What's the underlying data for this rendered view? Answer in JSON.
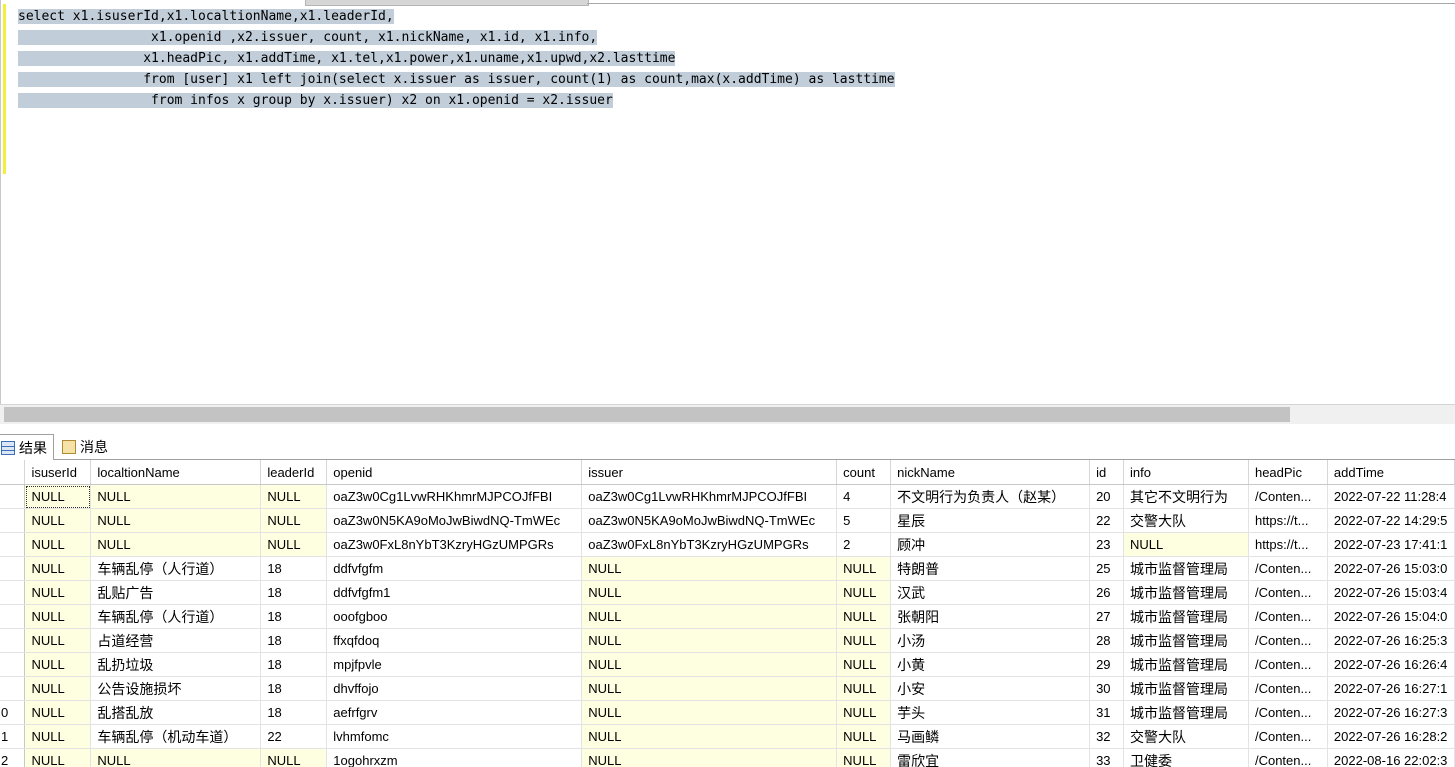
{
  "editor": {
    "lines": [
      "select x1.isuserId,x1.localtionName,x1.leaderId,",
      "                 x1.openid ,x2.issuer, count, x1.nickName, x1.id, x1.info,",
      "                x1.headPic, x1.addTime, x1.tel,x1.power,x1.uname,x1.upwd,x2.lasttime",
      "                from [user] x1 left join(select x.issuer as issuer, count(1) as count,max(x.addTime) as lasttime",
      "                 from infos x group by x.issuer) x2 on x1.openid = x2.issuer"
    ]
  },
  "results": {
    "tabs": [
      {
        "label": "结果",
        "icon": "grid-icon"
      },
      {
        "label": "消息",
        "icon": "messages-icon"
      }
    ],
    "columns": [
      "isuserId",
      "localtionName",
      "leaderId",
      "openid",
      "issuer",
      "count",
      "nickName",
      "id",
      "info",
      "headPic",
      "addTime"
    ],
    "rows": [
      {
        "rownum": "",
        "cells": [
          "NULL",
          "NULL",
          "NULL",
          "oaZ3w0Cg1LvwRHKhmrMJPCOJfFBI",
          "oaZ3w0Cg1LvwRHKhmrMJPCOJfFBI",
          "4",
          "不文明行为负责人（赵某）",
          "20",
          "其它不文明行为",
          "/Conten...",
          "2022-07-22 11:28:4"
        ]
      },
      {
        "rownum": "",
        "cells": [
          "NULL",
          "NULL",
          "NULL",
          "oaZ3w0N5KA9oMoJwBiwdNQ-TmWEc",
          "oaZ3w0N5KA9oMoJwBiwdNQ-TmWEc",
          "5",
          "星辰",
          "22",
          "交警大队",
          "https://t...",
          "2022-07-22 14:29:5"
        ]
      },
      {
        "rownum": "",
        "cells": [
          "NULL",
          "NULL",
          "NULL",
          "oaZ3w0FxL8nYbT3KzryHGzUMPGRs",
          "oaZ3w0FxL8nYbT3KzryHGzUMPGRs",
          "2",
          "顾冲",
          "23",
          "NULL",
          "https://t...",
          "2022-07-23 17:41:1"
        ]
      },
      {
        "rownum": "",
        "cells": [
          "NULL",
          "车辆乱停（人行道）",
          "18",
          "ddfvfgfm",
          "NULL",
          "NULL",
          "特朗普",
          "25",
          "城市监督管理局",
          "/Conten...",
          "2022-07-26 15:03:0"
        ]
      },
      {
        "rownum": "",
        "cells": [
          "NULL",
          "乱贴广告",
          "18",
          "ddfvfgfm1",
          "NULL",
          "NULL",
          "汉武",
          "26",
          "城市监督管理局",
          "/Conten...",
          "2022-07-26 15:03:4"
        ]
      },
      {
        "rownum": "",
        "cells": [
          "NULL",
          "车辆乱停（人行道）",
          "18",
          "ooofgboo",
          "NULL",
          "NULL",
          "张朝阳",
          "27",
          "城市监督管理局",
          "/Conten...",
          "2022-07-26 15:04:0"
        ]
      },
      {
        "rownum": "",
        "cells": [
          "NULL",
          "占道经营",
          "18",
          "ffxqfdoq",
          "NULL",
          "NULL",
          " 小汤",
          "28",
          "城市监督管理局",
          "/Conten...",
          "2022-07-26 16:25:3"
        ]
      },
      {
        "rownum": "",
        "cells": [
          "NULL",
          "乱扔垃圾",
          "18",
          "mpjfpvle",
          "NULL",
          "NULL",
          "小黄",
          "29",
          "城市监督管理局",
          "/Conten...",
          "2022-07-26 16:26:4"
        ]
      },
      {
        "rownum": "",
        "cells": [
          "NULL",
          "公告设施损坏",
          "18",
          "dhvffojo",
          "NULL",
          "NULL",
          "小安",
          "30",
          "城市监督管理局",
          "/Conten...",
          "2022-07-26 16:27:1"
        ]
      },
      {
        "rownum": "0",
        "cells": [
          "NULL",
          "乱搭乱放",
          "18",
          "aefrfgrv",
          "NULL",
          "NULL",
          "芋头",
          "31",
          "城市监督管理局",
          "/Conten...",
          "2022-07-26 16:27:3"
        ]
      },
      {
        "rownum": "1",
        "cells": [
          "NULL",
          "车辆乱停（机动车道）",
          "22",
          "lvhmfomc",
          "NULL",
          "NULL",
          "马画鳞",
          "32",
          "交警大队",
          "/Conten...",
          "2022-07-26 16:28:2"
        ]
      },
      {
        "rownum": "2",
        "cells": [
          "NULL",
          "NULL",
          "NULL",
          "1ogohrxzm",
          "NULL",
          "NULL",
          "雷欣宜",
          "33",
          "卫健委",
          "/Conten...",
          "2022-08-16 22:02:3"
        ]
      }
    ]
  },
  "colors": {
    "selection": "#c1cdd9",
    "null_cell": "#fefee0",
    "change_bar": "#f2ef3a"
  }
}
